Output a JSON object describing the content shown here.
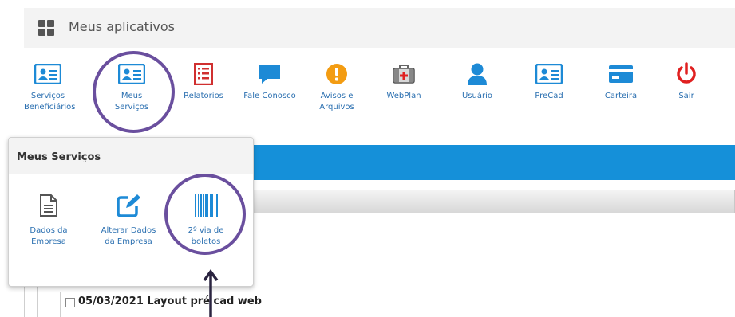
{
  "header": {
    "title": "Meus aplicativos",
    "icon": "grid-icon"
  },
  "apps": [
    {
      "label": "Serviços Beneficiários",
      "line1": "Serviços",
      "line2": "Beneficiários",
      "icon": "id-card-icon"
    },
    {
      "label": "Meus Serviços",
      "line1": "Meus",
      "line2": "Serviços",
      "icon": "id-card-icon"
    },
    {
      "label": "Relatorios",
      "line1": "Relatorios",
      "line2": "",
      "icon": "report-icon"
    },
    {
      "label": "Fale Conosco",
      "line1": "Fale Conosco",
      "line2": "",
      "icon": "chat-icon"
    },
    {
      "label": "Avisos e Arquivos",
      "line1": "Avisos e",
      "line2": "Arquivos",
      "icon": "warning-icon"
    },
    {
      "label": "WebPlan",
      "line1": "WebPlan",
      "line2": "",
      "icon": "medkit-icon"
    },
    {
      "label": "Usuário",
      "line1": "Usuário",
      "line2": "",
      "icon": "user-icon"
    },
    {
      "label": "PreCad",
      "line1": "PreCad",
      "line2": "",
      "icon": "id-card-icon"
    },
    {
      "label": "Carteira",
      "line1": "Carteira",
      "line2": "",
      "icon": "credit-card-icon"
    },
    {
      "label": "Sair",
      "line1": "Sair",
      "line2": "",
      "icon": "power-icon"
    }
  ],
  "popup": {
    "title": "Meus Serviços",
    "items": [
      {
        "line1": "Dados da",
        "line2": "Empresa",
        "icon": "document-icon"
      },
      {
        "line1": "Alterar Dados",
        "line2": "da Empresa",
        "icon": "edit-icon"
      },
      {
        "line1": "2º via de",
        "line2": "boletos",
        "icon": "barcode-icon"
      }
    ]
  },
  "row": {
    "text": "05/03/2021 Layout pré cad web"
  },
  "colors": {
    "link": "#2a6fb0",
    "blue_bar": "#1590d9",
    "highlight": "#6a4f9e",
    "power": "#e02020",
    "report": "#d03030",
    "warning": "#f39c12"
  }
}
